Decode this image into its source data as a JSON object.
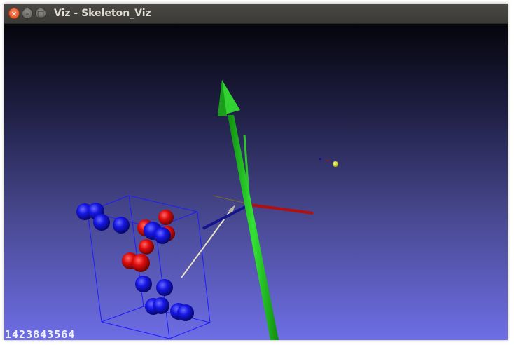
{
  "window": {
    "title": "Viz - Skeleton_Viz",
    "close_glyph": "×",
    "minimize_glyph": "–",
    "maximize_glyph": "□"
  },
  "viewport": {
    "background_top": "#05050c",
    "background_bottom": "#6e6ee6",
    "frame_counter": "1423843564",
    "colors": {
      "joint_left": "#1010dd",
      "joint_right": "#dd0a0a",
      "bounding_box": "#1d1dff",
      "axis_x": "#b01010",
      "axis_y": "#18c018",
      "axis_z": "#14148c",
      "camera_marker": "#d8e81a"
    },
    "icons": {
      "close": "close-icon",
      "minimize": "minimize-icon",
      "maximize": "maximize-icon"
    }
  }
}
